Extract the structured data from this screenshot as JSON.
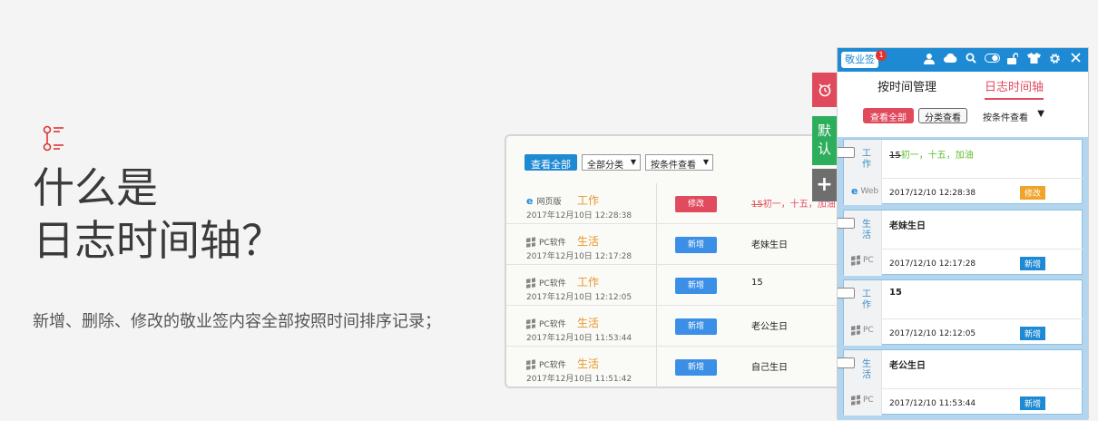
{
  "intro": {
    "title_line1": "什么是",
    "title_line2": "日志时间轴？",
    "description": "新增、删除、修改的敬业签内容全部按照时间排序记录；",
    "icon": "timeline-icon"
  },
  "mid_panel": {
    "toolbar": {
      "view_all": "查看全部",
      "category_select": "全部分类",
      "condition_select": "按条件查看"
    },
    "rows": [
      {
        "source": "网页版",
        "source_icon": "ie-icon",
        "category": "工作",
        "time": "2017年12月10日 12:28:38",
        "action": "修改",
        "action_type": "edit",
        "text_strike": "15",
        "text_rest": "初一，十五，加油"
      },
      {
        "source": "PC软件",
        "source_icon": "windows-icon",
        "category": "生活",
        "time": "2017年12月10日 12:17:28",
        "action": "新增",
        "action_type": "add",
        "text_strike": "",
        "text_rest": "老妹生日"
      },
      {
        "source": "PC软件",
        "source_icon": "windows-icon",
        "category": "工作",
        "time": "2017年12月10日 12:12:05",
        "action": "新增",
        "action_type": "add",
        "text_strike": "",
        "text_rest": "15"
      },
      {
        "source": "PC软件",
        "source_icon": "windows-icon",
        "category": "生活",
        "time": "2017年12月10日 11:53:44",
        "action": "新增",
        "action_type": "add",
        "text_strike": "",
        "text_rest": "老公生日"
      },
      {
        "source": "PC软件",
        "source_icon": "windows-icon",
        "category": "生活",
        "time": "2017年12月10日 11:51:42",
        "action": "新增",
        "action_type": "add",
        "text_strike": "",
        "text_rest": "自己生日"
      }
    ]
  },
  "side_tabs": {
    "alarm_icon": "alarm-clock-icon",
    "default_label": "默认",
    "add_label": "+"
  },
  "app": {
    "brand": "敬业签",
    "badge_count": "1",
    "header_icons": [
      "user-icon",
      "cloud-icon",
      "search-icon",
      "toggle-icon",
      "unlock-icon",
      "shirt-icon",
      "gear-icon",
      "close-icon"
    ],
    "tabs": {
      "by_time": "按时间管理",
      "log_timeline": "日志时间轴"
    },
    "toolbar": {
      "view_all": "查看全部",
      "by_category": "分类查看",
      "by_condition": "按条件查看"
    },
    "cards": [
      {
        "category": "工作",
        "source": "Web",
        "source_icon": "ie-icon",
        "content_strike": "15",
        "content_rest": "初一，十五，加油",
        "time": "2017/12/10 12:28:38",
        "action": "修改",
        "action_type": "edit"
      },
      {
        "category": "生活",
        "source": "PC",
        "source_icon": "windows-icon",
        "content_strike": "",
        "content_rest": "老妹生日",
        "time": "2017/12/10 12:17:28",
        "action": "新增",
        "action_type": "add"
      },
      {
        "category": "工作",
        "source": "PC",
        "source_icon": "windows-icon",
        "content_strike": "",
        "content_rest": "15",
        "time": "2017/12/10 12:12:05",
        "action": "新增",
        "action_type": "add"
      },
      {
        "category": "生活",
        "source": "PC",
        "source_icon": "windows-icon",
        "content_strike": "",
        "content_rest": "老公生日",
        "time": "2017/12/10 11:53:44",
        "action": "新增",
        "action_type": "add"
      }
    ]
  },
  "colors": {
    "blue": "#1f8ad4",
    "red": "#e04a5c",
    "green": "#2cae5c",
    "orange": "#e8962c"
  }
}
